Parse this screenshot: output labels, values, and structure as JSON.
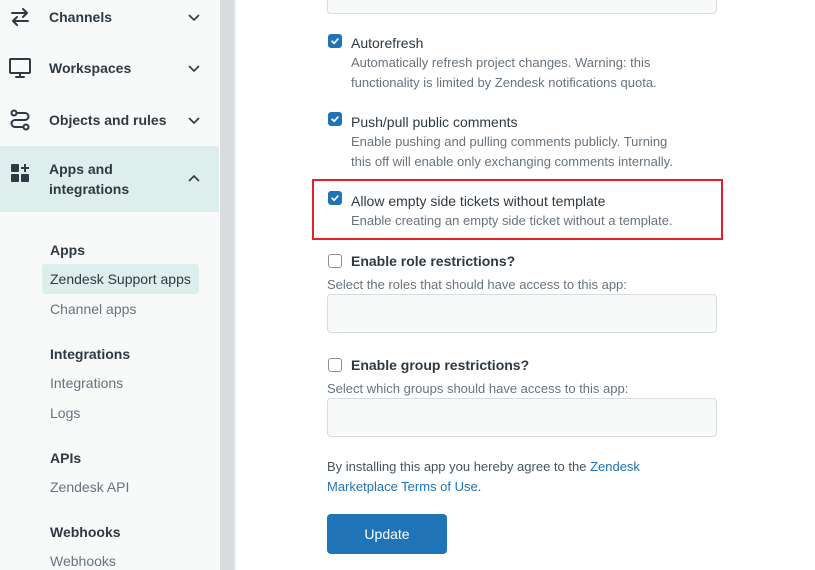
{
  "sidebar": {
    "nav": [
      {
        "label": "Channels",
        "icon": "arrows-swap-icon"
      },
      {
        "label": "Workspaces",
        "icon": "monitor-icon"
      },
      {
        "label": "Objects and rules",
        "icon": "route-icon"
      },
      {
        "label": "Apps and integrations",
        "label_line1": "Apps and",
        "label_line2": "integrations",
        "icon": "grid-plus-icon",
        "active": true
      }
    ],
    "sections": [
      {
        "heading": "Apps",
        "links": [
          "Zendesk Support apps",
          "Channel apps"
        ]
      },
      {
        "heading": "Integrations",
        "links": [
          "Integrations",
          "Logs"
        ]
      },
      {
        "heading": "APIs",
        "links": [
          "Zendesk API"
        ]
      },
      {
        "heading": "Webhooks",
        "links": [
          "Webhooks"
        ]
      }
    ],
    "selected_link": "Zendesk Support apps"
  },
  "settings": {
    "autorefresh": {
      "label": "Autorefresh",
      "hint_line1": "Automatically refresh project changes. Warning: this",
      "hint_line2": "functionality is limited by Zendesk notifications quota.",
      "checked": true
    },
    "push_pull": {
      "label": "Push/pull public comments",
      "hint_line1": "Enable pushing and pulling comments publicly. Turning",
      "hint_line2": "this off will enable only exchanging comments internally.",
      "checked": true
    },
    "empty_side": {
      "label": "Allow empty side tickets without template",
      "hint": "Enable creating an empty side ticket without a template.",
      "checked": true
    },
    "role_restrictions": {
      "label": "Enable role restrictions?",
      "hint": "Select the roles that should have access to this app:",
      "checked": false
    },
    "group_restrictions": {
      "label": "Enable group restrictions?",
      "hint": "Select which groups should have access to this app:",
      "checked": false
    }
  },
  "footer": {
    "agree_text": "By installing this app you hereby agree to the ",
    "agree_link_line1": "Zendesk",
    "agree_link_line2": "Marketplace Terms of Use",
    "agree_end": ".",
    "update_label": "Update"
  },
  "colors": {
    "accent": "#1f73b7",
    "active_bg": "#deeeec",
    "highlight": "#e4212a"
  }
}
